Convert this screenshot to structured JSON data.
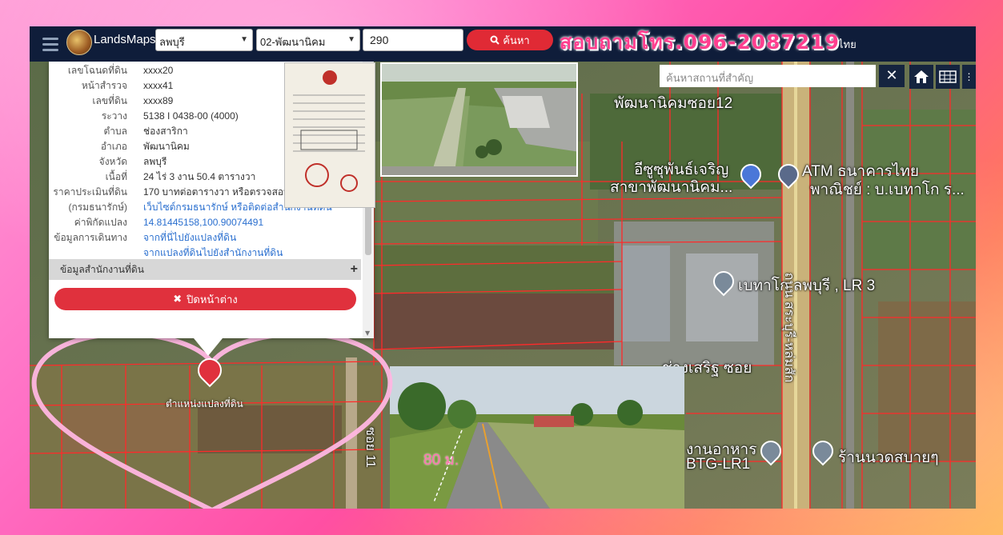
{
  "topbar": {
    "brand": "LandsMaps",
    "province": "ลพบุรี",
    "district": "02-พัฒนานิคม",
    "parcel_no": "290",
    "search_label": "ค้นหา",
    "phone_overlay": "สอบถามโทร.096-2087219",
    "lang_label": "ไทย"
  },
  "map_search": {
    "placeholder": "ค้นหาสถานที่สำคัญ",
    "clear": "✕"
  },
  "info": {
    "rows": [
      {
        "k": "เลขโฉนดที่ดิน",
        "v": "xxxx20"
      },
      {
        "k": "หน้าสำรวจ",
        "v": "xxxx41"
      },
      {
        "k": "เลขที่ดิน",
        "v": "xxxx89"
      },
      {
        "k": "ระวาง",
        "v": "5138 I 0438-00 (4000)"
      },
      {
        "k": "ตำบล",
        "v": "ช่องสาริกา"
      },
      {
        "k": "อำเภอ",
        "v": "พัฒนานิคม"
      },
      {
        "k": "จังหวัด",
        "v": "ลพบุรี"
      },
      {
        "k": "เนื้อที่",
        "v": "24 ไร่ 3 งาน 50.4 ตารางวา"
      },
      {
        "k": "ราคาประเมินที่ดิน",
        "v": "170 บาทต่อตารางวา หรือตรวจสอบ"
      },
      {
        "k": "(กรมธนารักษ์)",
        "v": "เว็บไซต์กรมธนารักษ์ หรือติดต่อสำนักงานที่ดิน"
      },
      {
        "k": "ค่าพิกัดแปลง",
        "v": "14.81445158,100.90074491"
      },
      {
        "k": "ข้อมูลการเดินทาง",
        "v": "จากที่นี่ไปยังแปลงที่ดิน"
      },
      {
        "k": "",
        "v": "จากแปลงที่ดินไปยังสำนักงานที่ดิน"
      }
    ],
    "section_label": "ข้อมูลสำนักงานที่ดิน",
    "close_label": "ปิดหน้าต่าง"
  },
  "map_labels": {
    "poi1": "พัฒนานิคมซอย12",
    "poi2": "อีซูซุพันธ์เจริญ",
    "poi2b": "สาขาพัฒนานิคม...",
    "poi3": "ATM ธนาคารไทย",
    "poi3b": "พาณิชย์ : บ.เบทาโก ร...",
    "poi4": "เบทาโก ลพบุรี , LR 3",
    "poi5": "ร้านนวดสบายๆ",
    "poi6": "งานอาหาร",
    "poi6b": "BTG-LR1",
    "poi7": "ช่างเสริฐ ซอย",
    "road1": "ซอย 11",
    "road2": "ถนน สระบุรี-หล่มสัก",
    "marker_label": "ตำแหน่งแปลงที่ดิน",
    "distance": "80 ม."
  }
}
